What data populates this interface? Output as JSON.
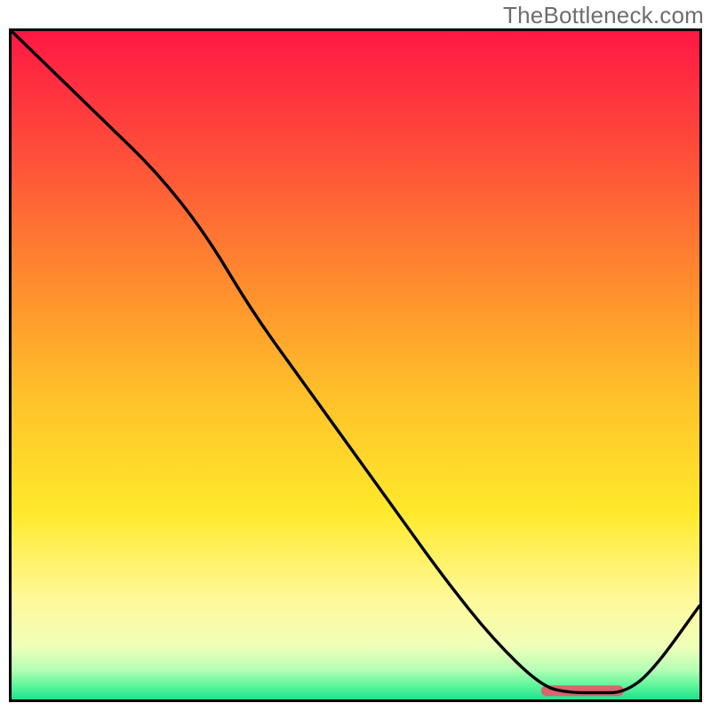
{
  "watermark": "TheBottleneck.com",
  "chart_data": {
    "type": "line",
    "title": "",
    "xlabel": "",
    "ylabel": "",
    "xlim": [
      0,
      100
    ],
    "ylim": [
      0,
      100
    ],
    "series": [
      {
        "name": "curve",
        "x": [
          0,
          7,
          14,
          21,
          28,
          35,
          42,
          49,
          56,
          63,
          70,
          77,
          81,
          85,
          89,
          93,
          100
        ],
        "y": [
          100,
          93,
          86,
          79,
          70,
          58,
          48,
          38,
          28,
          18,
          9,
          2,
          1,
          1,
          1,
          4,
          14
        ]
      }
    ],
    "marker_band": {
      "x0": 77,
      "x1": 89,
      "y": 1.3,
      "thickness": 1.6,
      "color": "#d9646c"
    },
    "gradient_stops": [
      {
        "offset": 0.0,
        "color": "#ff1844"
      },
      {
        "offset": 0.18,
        "color": "#ff4d3a"
      },
      {
        "offset": 0.38,
        "color": "#ff8d2e"
      },
      {
        "offset": 0.55,
        "color": "#ffc22a"
      },
      {
        "offset": 0.72,
        "color": "#ffe92b"
      },
      {
        "offset": 0.85,
        "color": "#fff99a"
      },
      {
        "offset": 0.92,
        "color": "#f0ffb8"
      },
      {
        "offset": 0.955,
        "color": "#b6ffb5"
      },
      {
        "offset": 0.98,
        "color": "#5cf59a"
      },
      {
        "offset": 1.0,
        "color": "#1de28e"
      }
    ]
  }
}
